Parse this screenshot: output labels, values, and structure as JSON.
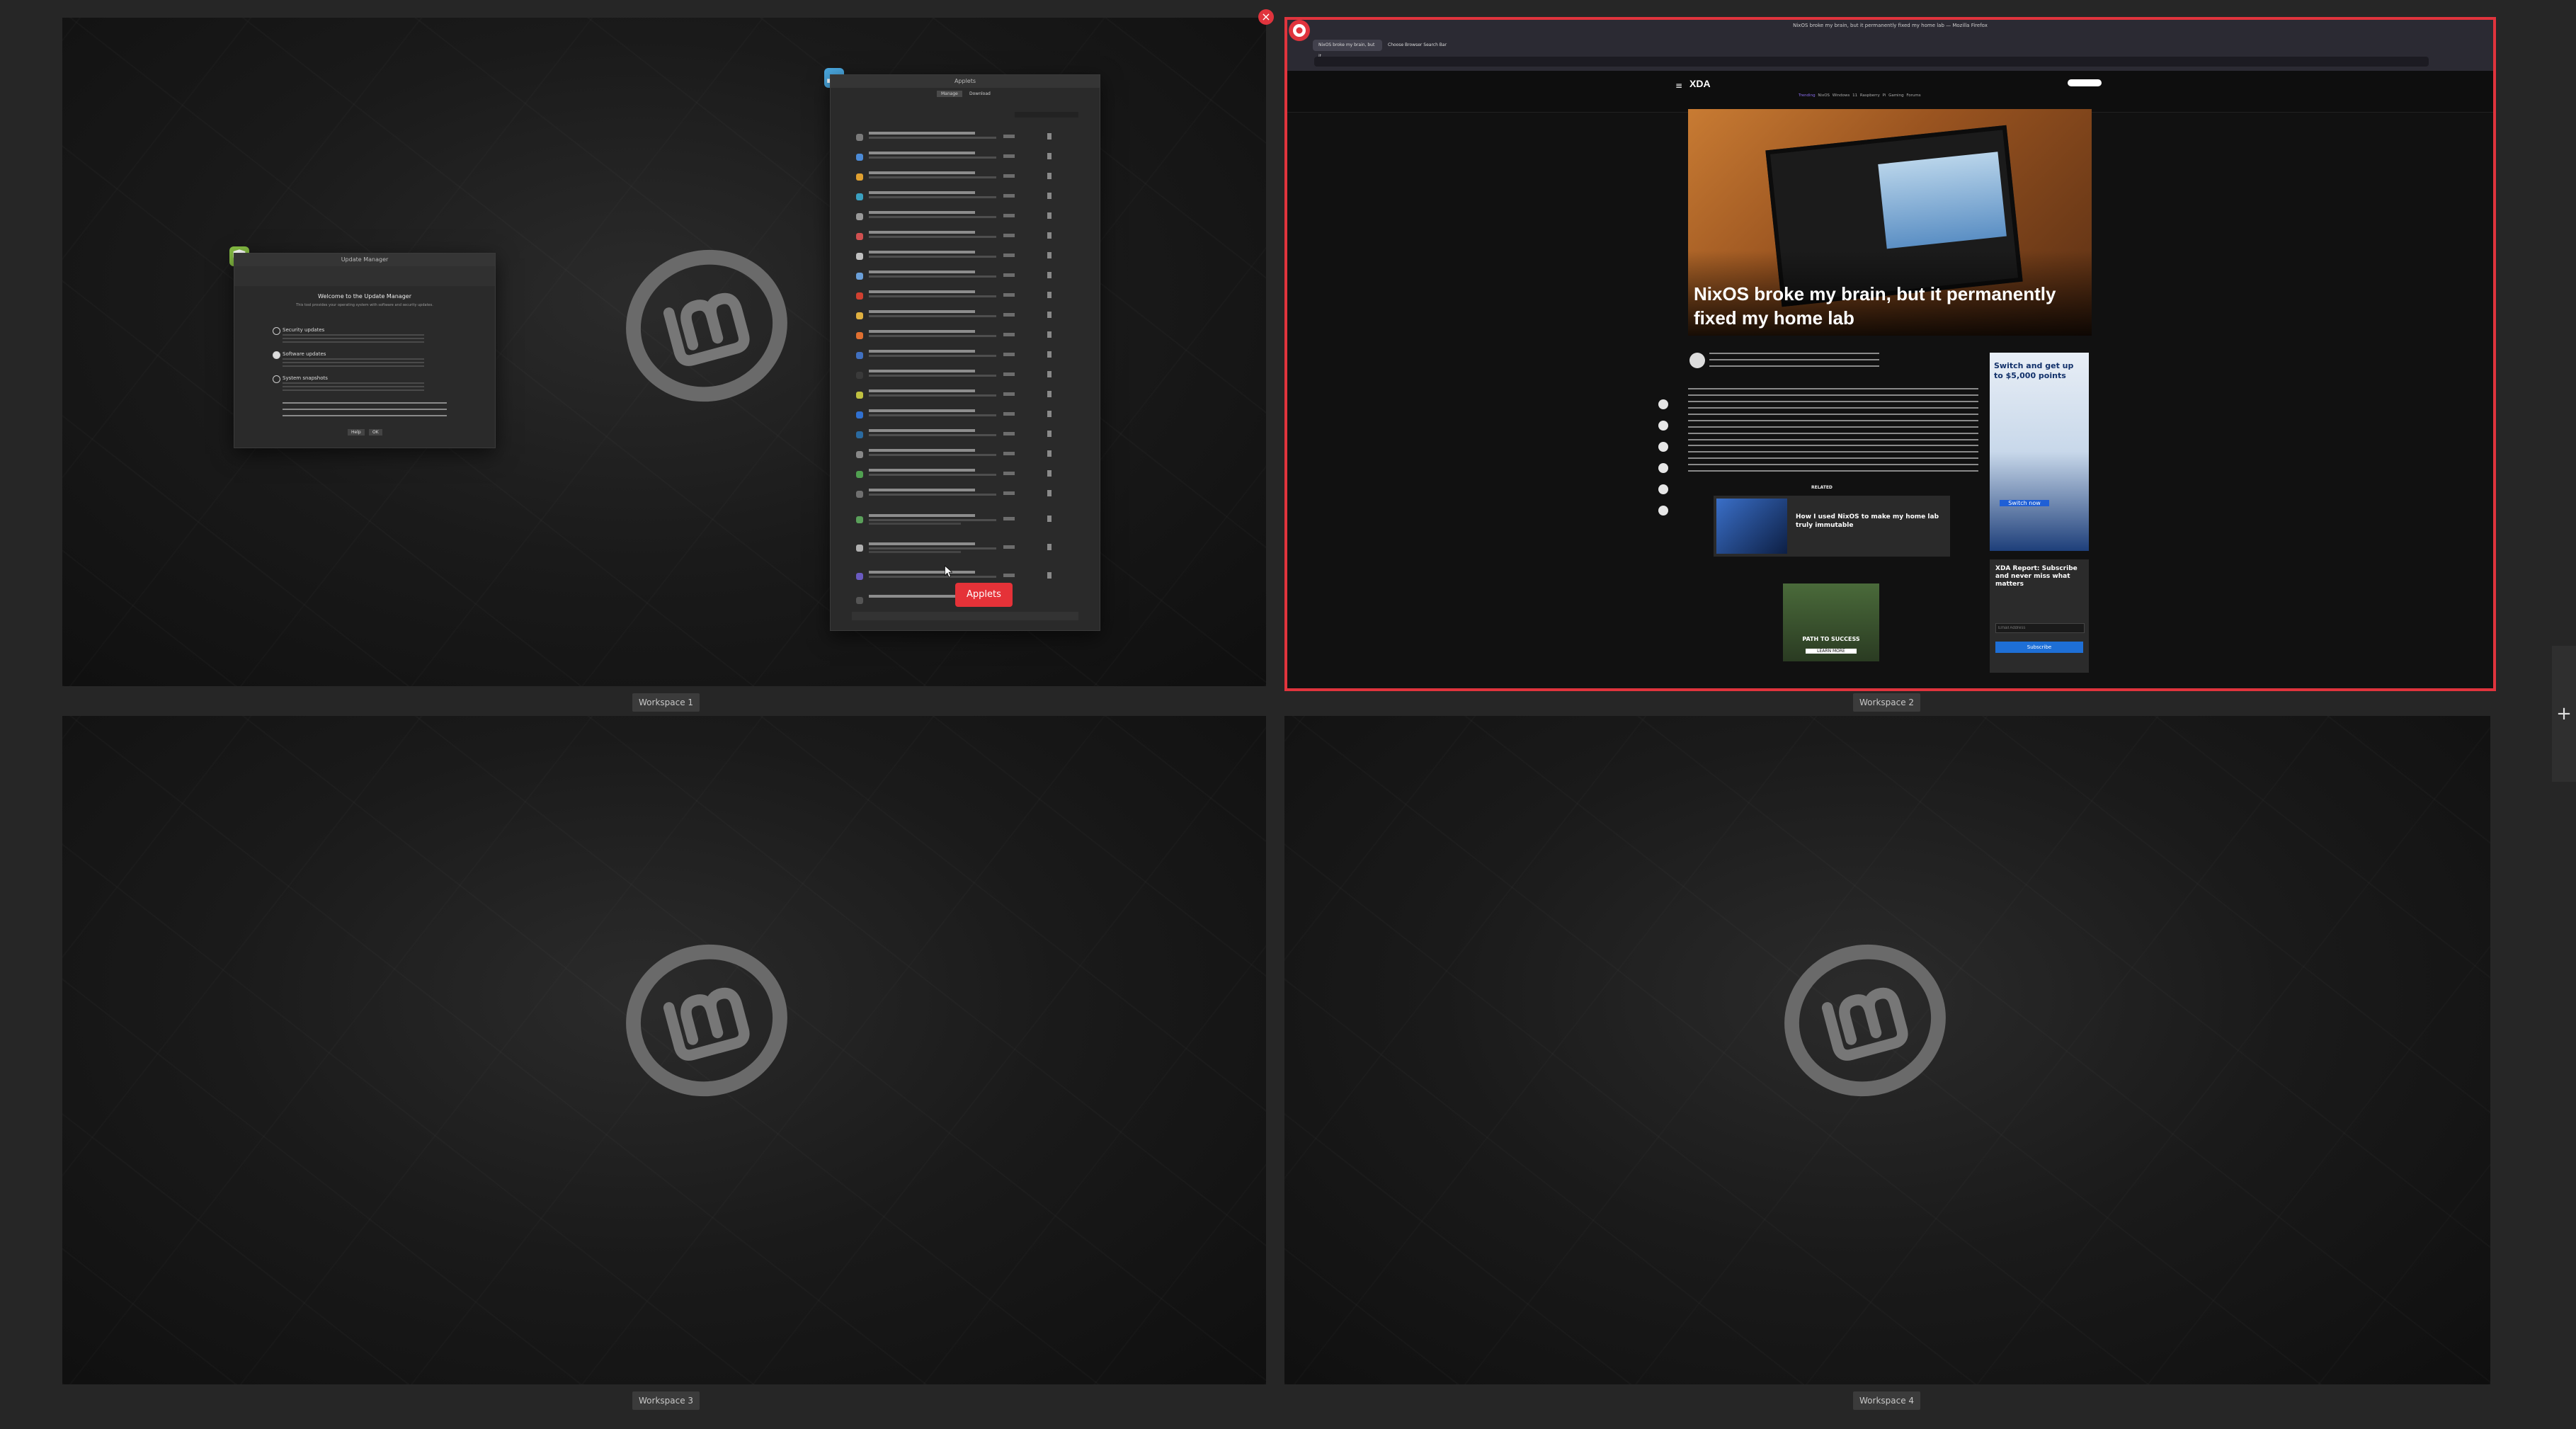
{
  "workspaces": [
    {
      "label": "Workspace 1"
    },
    {
      "label": "Workspace 2"
    },
    {
      "label": "Workspace 3"
    },
    {
      "label": "Workspace 4"
    }
  ],
  "controls": {
    "close_glyph": "×",
    "add_glyph": "+"
  },
  "update_manager": {
    "title": "Update Manager",
    "heading": "Welcome to the Update Manager",
    "intro": "This tool provides your operating system with software and security updates.",
    "options": [
      "Security updates",
      "Software updates",
      "System snapshots"
    ],
    "buttons": {
      "help": "Help",
      "ok": "OK"
    }
  },
  "applets": {
    "title": "Applets",
    "tabs": [
      "Manage",
      "Download"
    ],
    "tooltip": "Applets",
    "rows": [
      "Automation Entry Right Column",
      "World Clock Calendar",
      "Radio Applet",
      "Heavy Desktop Wallpaper",
      "Brightness and gamma applet",
      "Favorites Panel",
      "Multi-IP",
      "Natural Applet with Numbering and Reordered (Identifier)",
      "Climate / Climatized Screens",
      "Keys switcher",
      "Sensors Manager",
      "Screen Ruler",
      "Batch Manager",
      "Radio Applet",
      "Desktop Blinds Manager",
      "DSP Torrent Applet",
      "Screen Shot",
      "Auto Sync",
      "Network Information",
      "Desktop Backgrounds",
      "IP Indicator",
      "Clean History Indicator",
      "Dock Mode"
    ]
  },
  "browser": {
    "window_title": "NixOS broke my brain, but it permanently fixed my home lab — Mozilla Firefox",
    "tabs": [
      "NixOS broke my brain, but it...",
      "Choose Browser Search Bar"
    ],
    "site_name": "XDA",
    "nav": [
      "Trending",
      "NixOS",
      "Windows 11",
      "Raspberry Pi",
      "Gaming",
      "Forums"
    ],
    "article_title": "NixOS broke my brain, but it permanently fixed my home lab",
    "related_label": "RELATED",
    "related_title": "How I used NixOS to make my home lab truly immutable",
    "ad_top": "Switch and get up to $5,000 points",
    "ad_cta": "Switch now",
    "ad_path": "PATH TO SUCCESS",
    "ad_learn": "LEARN MORE",
    "newsletter_title": "XDA Report: Subscribe and never miss what matters",
    "newsletter_placeholder": "Email Address",
    "newsletter_button": "Subscribe"
  },
  "colors": {
    "accent": "#e0343d",
    "mint_green": "#86be43",
    "applet_blue": "#4aa8e0",
    "panel_bg": "#2a2a2a"
  },
  "icons": [
    "mint-logo-icon",
    "shield-icon",
    "applets-icon",
    "firefox-icon"
  ]
}
